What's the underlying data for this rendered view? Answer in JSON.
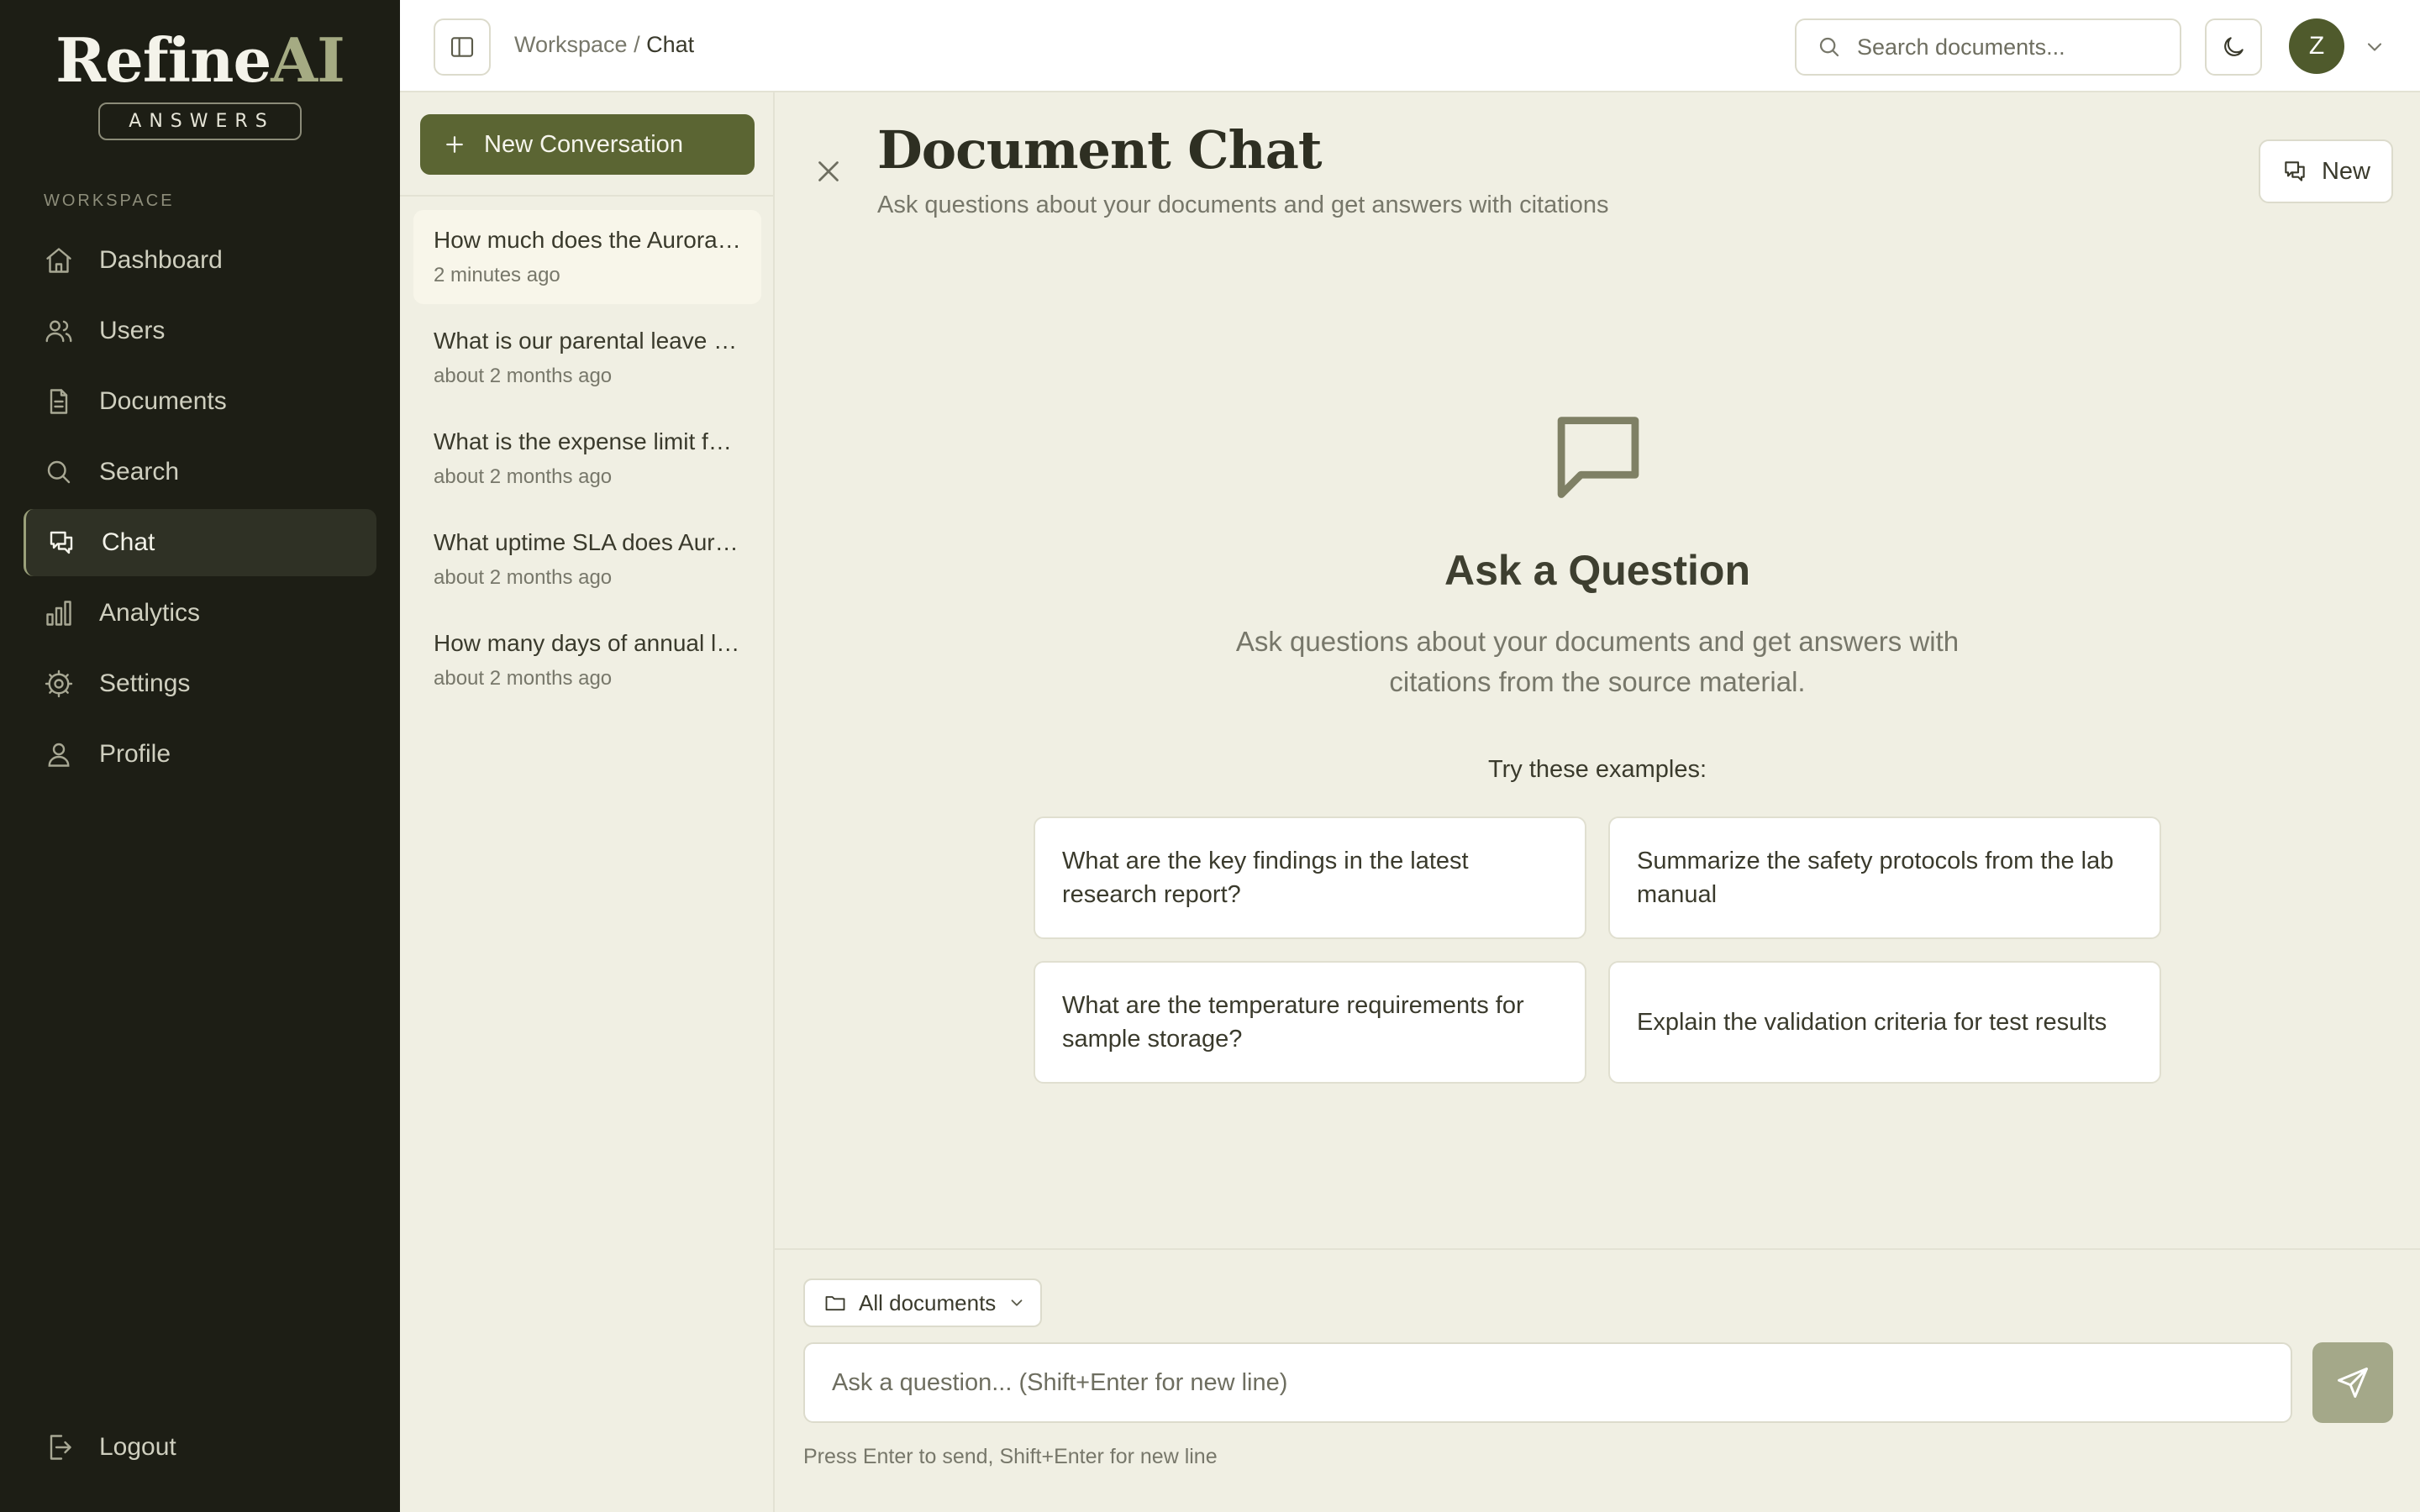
{
  "sidebar": {
    "logo_main": "Refine",
    "logo_accent": "AI",
    "logo_sub": "ANSWERS",
    "section_label": "WORKSPACE",
    "items": [
      {
        "label": "Dashboard",
        "icon": "home-icon"
      },
      {
        "label": "Users",
        "icon": "users-icon"
      },
      {
        "label": "Documents",
        "icon": "document-icon"
      },
      {
        "label": "Search",
        "icon": "search-icon"
      },
      {
        "label": "Chat",
        "icon": "chat-icon",
        "active": true
      },
      {
        "label": "Analytics",
        "icon": "bar-chart-icon"
      },
      {
        "label": "Settings",
        "icon": "gear-icon"
      },
      {
        "label": "Profile",
        "icon": "user-icon"
      }
    ],
    "logout_label": "Logout"
  },
  "topbar": {
    "breadcrumb_root": "Workspace",
    "breadcrumb_separator": "/",
    "breadcrumb_current": "Chat",
    "search_placeholder": "Search documents...",
    "avatar_initial": "Z"
  },
  "conversations": {
    "new_button_label": "New Conversation",
    "items": [
      {
        "title": "How much does the Aurora Cloud Platform cost?",
        "time": "2 minutes ago",
        "active": true
      },
      {
        "title": "What is our parental leave policy?",
        "time": "about 2 months ago"
      },
      {
        "title": "What is the expense limit for travel?",
        "time": "about 2 months ago"
      },
      {
        "title": "What uptime SLA does Aurora offer?",
        "time": "about 2 months ago"
      },
      {
        "title": "How many days of annual leave do we get?",
        "time": "about 2 months ago"
      }
    ]
  },
  "main": {
    "title": "Document Chat",
    "subtitle": "Ask questions about your documents and get answers with citations",
    "new_button_label": "New",
    "empty_title": "Ask a Question",
    "empty_description": "Ask questions about your documents and get answers with citations from the source material.",
    "examples_label": "Try these examples:",
    "examples": [
      "What are the key findings in the latest research report?",
      "Summarize the safety protocols from the lab manual",
      "What are the temperature requirements for sample storage?",
      "Explain the validation criteria for test results"
    ]
  },
  "input": {
    "document_filter": "All documents",
    "placeholder": "Ask a question... (Shift+Enter for new line)",
    "value": "",
    "hint": "Press Enter to send, Shift+Enter for new line"
  },
  "colors": {
    "sidebar_bg": "#1d1e15",
    "page_bg": "#f0efe3",
    "accent": "#5b6533",
    "send_button": "#a4a889",
    "logo_accent": "#a5ab83"
  }
}
